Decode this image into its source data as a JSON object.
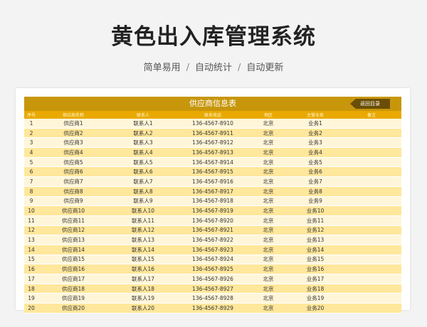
{
  "page": {
    "title": "黄色出入库管理系统",
    "subtitle_parts": [
      "简单易用",
      "自动统计",
      "自动更新"
    ],
    "subtitle_sep": "/"
  },
  "sheet": {
    "banner_title": "供应商信息表",
    "back_button": "返回目录",
    "headers": [
      "序号",
      "供应商名称",
      "联系人",
      "联系电话",
      "地区",
      "主营业务",
      "备注"
    ],
    "rows": [
      [
        "1",
        "供应商1",
        "联系人1",
        "136-4567-8910",
        "北京",
        "业务1",
        ""
      ],
      [
        "2",
        "供应商2",
        "联系人2",
        "136-4567-8911",
        "北京",
        "业务2",
        ""
      ],
      [
        "3",
        "供应商3",
        "联系人3",
        "136-4567-8912",
        "北京",
        "业务3",
        ""
      ],
      [
        "4",
        "供应商4",
        "联系人4",
        "136-4567-8913",
        "北京",
        "业务4",
        ""
      ],
      [
        "5",
        "供应商5",
        "联系人5",
        "136-4567-8914",
        "北京",
        "业务5",
        ""
      ],
      [
        "6",
        "供应商6",
        "联系人6",
        "136-4567-8915",
        "北京",
        "业务6",
        ""
      ],
      [
        "7",
        "供应商7",
        "联系人7",
        "136-4567-8916",
        "北京",
        "业务7",
        ""
      ],
      [
        "8",
        "供应商8",
        "联系人8",
        "136-4567-8917",
        "北京",
        "业务8",
        ""
      ],
      [
        "9",
        "供应商9",
        "联系人9",
        "136-4567-8918",
        "北京",
        "业务9",
        ""
      ],
      [
        "10",
        "供应商10",
        "联系人10",
        "136-4567-8919",
        "北京",
        "业务10",
        ""
      ],
      [
        "11",
        "供应商11",
        "联系人11",
        "136-4567-8920",
        "北京",
        "业务11",
        ""
      ],
      [
        "12",
        "供应商12",
        "联系人12",
        "136-4567-8921",
        "北京",
        "业务12",
        ""
      ],
      [
        "13",
        "供应商13",
        "联系人13",
        "136-4567-8922",
        "北京",
        "业务13",
        ""
      ],
      [
        "14",
        "供应商14",
        "联系人14",
        "136-4567-8923",
        "北京",
        "业务14",
        ""
      ],
      [
        "15",
        "供应商15",
        "联系人15",
        "136-4567-8924",
        "北京",
        "业务15",
        ""
      ],
      [
        "16",
        "供应商16",
        "联系人16",
        "136-4567-8925",
        "北京",
        "业务16",
        ""
      ],
      [
        "17",
        "供应商17",
        "联系人17",
        "136-4567-8926",
        "北京",
        "业务17",
        ""
      ],
      [
        "18",
        "供应商18",
        "联系人18",
        "136-4567-8927",
        "北京",
        "业务18",
        ""
      ],
      [
        "19",
        "供应商19",
        "联系人19",
        "136-4567-8928",
        "北京",
        "业务19",
        ""
      ],
      [
        "20",
        "供应商20",
        "联系人20",
        "136-4567-8929",
        "北京",
        "业务20",
        ""
      ]
    ]
  },
  "colors": {
    "banner": "#c7960b",
    "header": "#e9a900",
    "row_light": "#fff6da",
    "row_dark": "#ffe79b",
    "back_button": "#6a4e05"
  }
}
